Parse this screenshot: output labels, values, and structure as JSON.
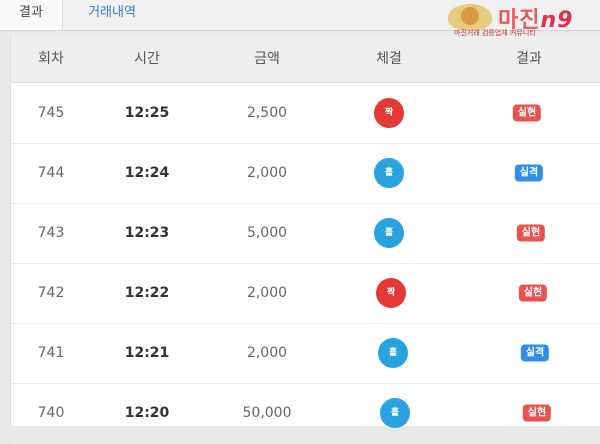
{
  "tabs": {
    "result": "결과",
    "history": "거래내역"
  },
  "logo": {
    "title": "마진",
    "number": "n9",
    "subtitle": "마진거래 검증업체 커뮤니티"
  },
  "table": {
    "headers": {
      "round": "회차",
      "time": "시간",
      "amount": "금액",
      "execution": "체결",
      "result": "결과"
    },
    "rows": [
      {
        "round": "745",
        "time": "12:25",
        "amount": "2,500",
        "execution": "짝",
        "execution_color": "#e53935",
        "result": "실현",
        "result_color": "#e8534f"
      },
      {
        "round": "744",
        "time": "12:24",
        "amount": "2,000",
        "execution": "홀",
        "execution_color": "#29a3e0",
        "result": "실격",
        "result_color": "#2f8ee6"
      },
      {
        "round": "743",
        "time": "12:23",
        "amount": "5,000",
        "execution": "홀",
        "execution_color": "#29a3e0",
        "result": "실현",
        "result_color": "#e8534f"
      },
      {
        "round": "742",
        "time": "12:22",
        "amount": "2,000",
        "execution": "짝",
        "execution_color": "#e53935",
        "result": "실현",
        "result_color": "#e8534f"
      },
      {
        "round": "741",
        "time": "12:21",
        "amount": "2,000",
        "execution": "홀",
        "execution_color": "#29a3e0",
        "result": "실격",
        "result_color": "#2f8ee6"
      },
      {
        "round": "740",
        "time": "12:20",
        "amount": "50,000",
        "execution": "홀",
        "execution_color": "#29a3e0",
        "result": "실현",
        "result_color": "#e8534f"
      }
    ]
  }
}
